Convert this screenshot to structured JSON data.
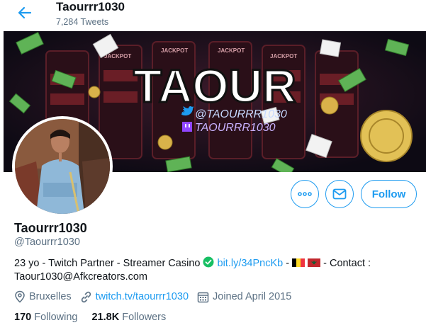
{
  "header": {
    "display_name": "Taourrr1030",
    "tweet_count": "7,284 Tweets"
  },
  "banner": {
    "logo_text": "TAOUR",
    "twitter_handle": "@TAOURRR1030",
    "twitch_handle": "TAOURRR1030",
    "jackpot_label": "JACKPOT"
  },
  "profile": {
    "name": "Taourrr1030",
    "handle": "@Taourrr1030",
    "bio": {
      "text_before": "23 yo - Twitch Partner - Streamer Casino ",
      "link": "bit.ly/34PncKb",
      "text_between": " - ",
      "text_after": " - Contact : Taour1030@Afkcreators.com"
    },
    "location": "Bruxelles",
    "website": "twitch.tv/taourrr1030",
    "joined": "Joined April 2015",
    "following_count": "170",
    "following_label": "Following",
    "followers_count": "21.8K",
    "followers_label": "Followers"
  },
  "actions": {
    "follow_label": "Follow"
  },
  "colors": {
    "accent": "#1d9bf0",
    "verified": "#17bf63",
    "muted": "#5b7083"
  }
}
